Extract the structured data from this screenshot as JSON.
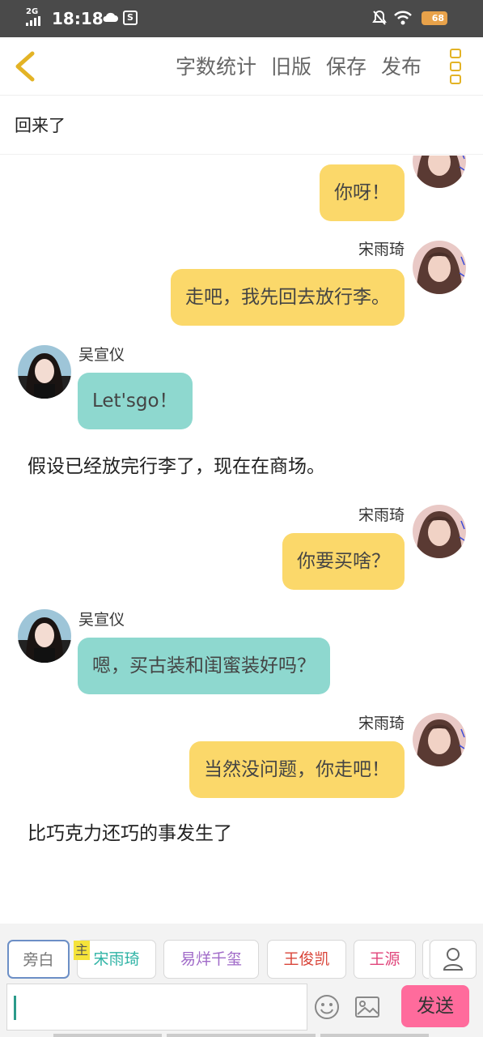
{
  "status_bar": {
    "network": "2G",
    "time": "18:18",
    "battery": "68"
  },
  "header": {
    "actions": [
      "字数统计",
      "旧版",
      "保存",
      "发布"
    ],
    "back_icon": "chevron-left-icon",
    "more_icon": "vertical-three-squares-icon"
  },
  "title": "回来了",
  "messages": [
    {
      "type": "bubble",
      "side": "right",
      "name": "",
      "text": "你呀！",
      "color": "#fbd86a"
    },
    {
      "type": "bubble",
      "side": "right",
      "name": "宋雨琦",
      "text": "走吧，我先回去放行李。",
      "color": "#fbd86a"
    },
    {
      "type": "bubble",
      "side": "left",
      "name": "吴宣仪",
      "text": "Let'sgo！",
      "color": "#8ed8cf"
    },
    {
      "type": "narration",
      "text": "假设已经放完行李了，现在在商场。"
    },
    {
      "type": "bubble",
      "side": "right",
      "name": "宋雨琦",
      "text": "你要买啥？",
      "color": "#fbd86a"
    },
    {
      "type": "bubble",
      "side": "left",
      "name": "吴宣仪",
      "text": "嗯，买古装和闺蜜装好吗？",
      "color": "#8ed8cf"
    },
    {
      "type": "bubble",
      "side": "right",
      "name": "宋雨琦",
      "text": "当然没问题，你走吧！",
      "color": "#fbd86a"
    },
    {
      "type": "narration",
      "text": "比巧克力还巧的事发生了"
    }
  ],
  "bottom": {
    "main_tag": "主",
    "chips": [
      {
        "label": "旁白",
        "color": "#777777"
      },
      {
        "label": "宋雨琦",
        "color": "#2fb3a5"
      },
      {
        "label": "易烊千玺",
        "color": "#a06ac8"
      },
      {
        "label": "王俊凯",
        "color": "#d9453a"
      },
      {
        "label": "王源",
        "color": "#e0457b"
      }
    ],
    "input_value": "",
    "send_label": "发送"
  }
}
